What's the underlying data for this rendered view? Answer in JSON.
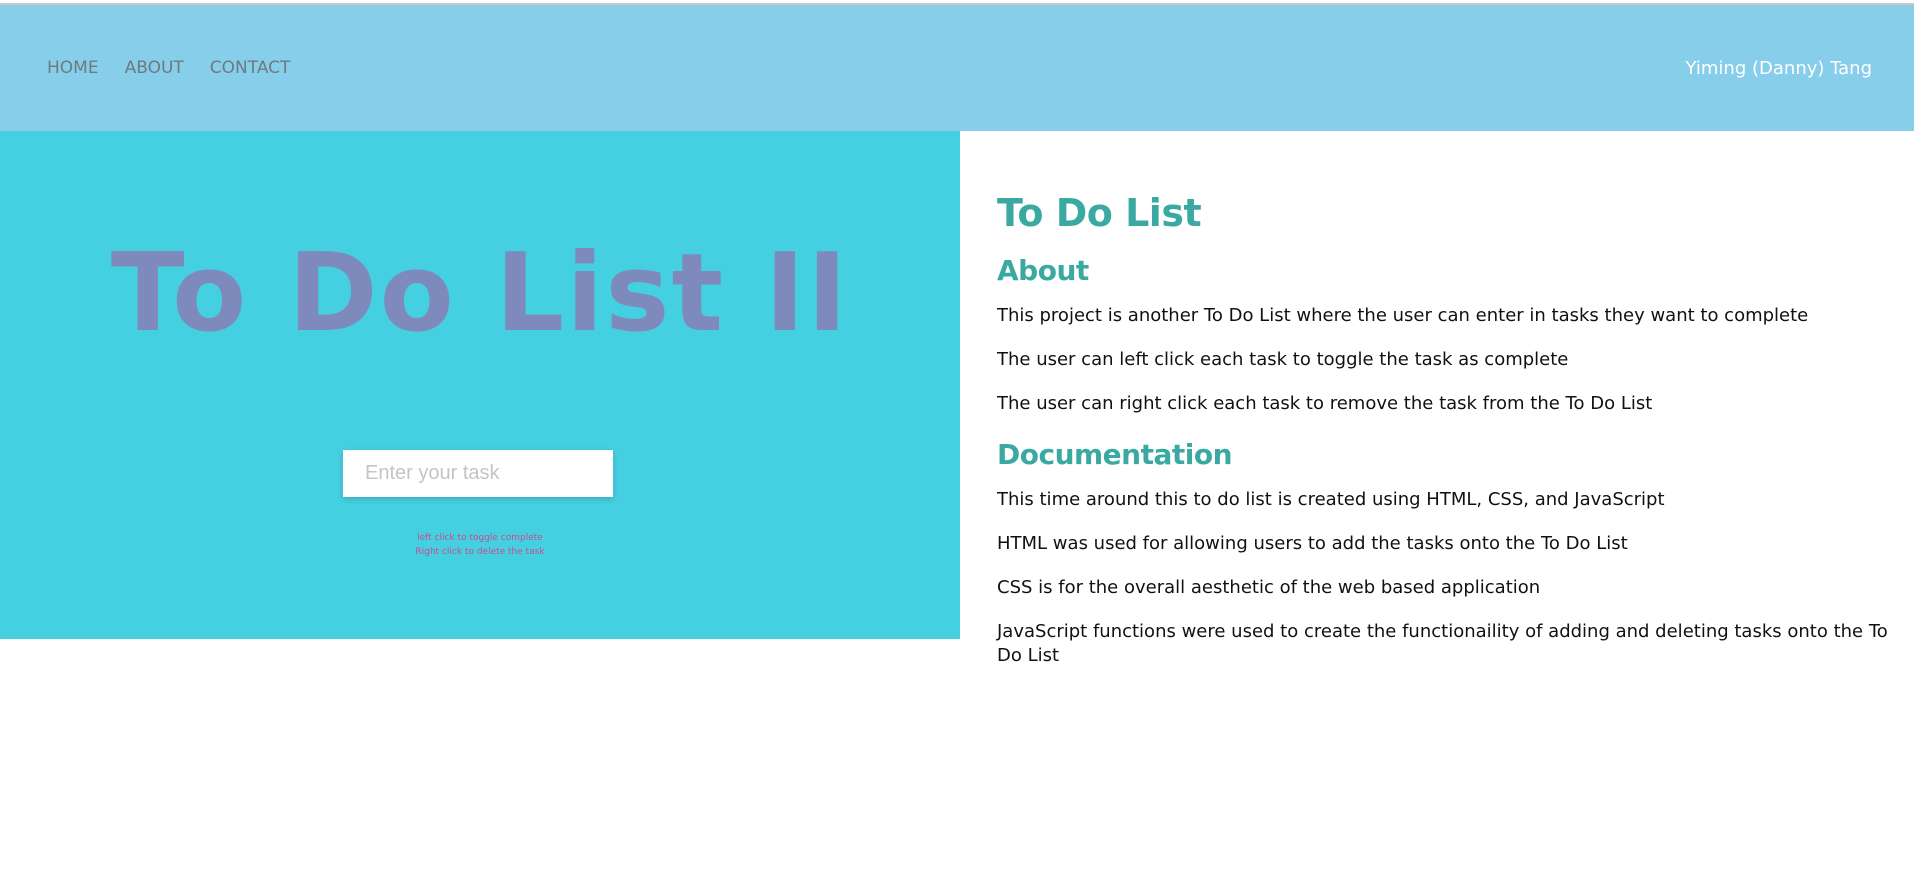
{
  "nav": {
    "links": [
      "HOME",
      "ABOUT",
      "CONTACT"
    ],
    "brand": "Yiming (Danny) Tang"
  },
  "preview": {
    "title": "To Do List II",
    "input_placeholder": "Enter your task",
    "hint_1": "left click to toggle complete",
    "hint_2": "Right click to delete the task"
  },
  "description": {
    "title": "To Do List",
    "about_heading": "About",
    "about": [
      "This project is another To Do List where the user can enter in tasks they want to complete",
      "The user can left click each task to toggle the task as complete",
      "The user can right click each task to remove the task from the To Do List"
    ],
    "doc_heading": "Documentation",
    "documentation": [
      "This time around this to do list is created using HTML, CSS, and JavaScript",
      "HTML was used for allowing users to add the tasks onto the To Do List",
      "CSS is for the overall aesthetic of the web based application",
      "JavaScript functions were used to create the functionaility of adding and deleting tasks onto the To Do List"
    ]
  },
  "colors": {
    "navbar": "#87ceeb",
    "preview_bg": "#45d0e2",
    "heading_teal": "#3aa9a2",
    "preview_title": "#7e89bc",
    "hint": "#c94b8e"
  }
}
